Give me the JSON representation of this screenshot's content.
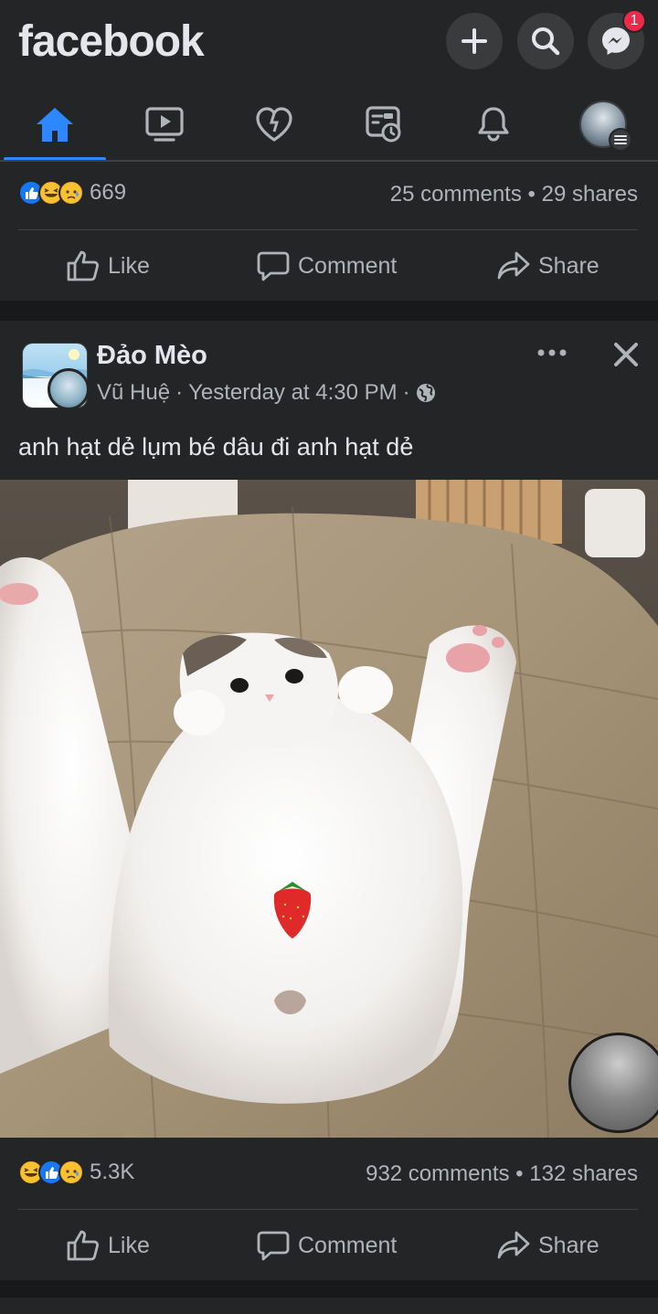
{
  "app": {
    "logo": "facebook"
  },
  "header": {
    "create_icon": "plus-icon",
    "search_icon": "search-icon",
    "messenger_icon": "messenger-icon",
    "messenger_badge": "1"
  },
  "tabs": [
    {
      "name": "home-icon",
      "active": true
    },
    {
      "name": "watch-icon",
      "active": false
    },
    {
      "name": "dating-icon",
      "active": false
    },
    {
      "name": "feeds-icon",
      "active": false
    },
    {
      "name": "bell-icon",
      "active": false
    },
    {
      "name": "profile-menu",
      "active": false
    }
  ],
  "colors": {
    "accent": "#2d88ff",
    "background": "#18191a",
    "card": "#242526",
    "badge": "#f02849"
  },
  "post1": {
    "reaction_count": "669",
    "comments": "25 comments",
    "shares": "29 shares",
    "actions": {
      "like": "Like",
      "comment": "Comment",
      "share": "Share"
    }
  },
  "post2": {
    "page_name": "Đảo Mèo",
    "author": "Vũ Huệ",
    "time": "Yesterday at 4:30 PM",
    "audience_icon": "globe-icon",
    "text": "anh hạt dẻ lụm bé dâu đi anh hạt dẻ",
    "reaction_count": "5.3K",
    "comments": "932 comments",
    "shares": "132 shares",
    "actions": {
      "like": "Like",
      "comment": "Comment",
      "share": "Share"
    }
  },
  "separator": "•",
  "dot": "·"
}
